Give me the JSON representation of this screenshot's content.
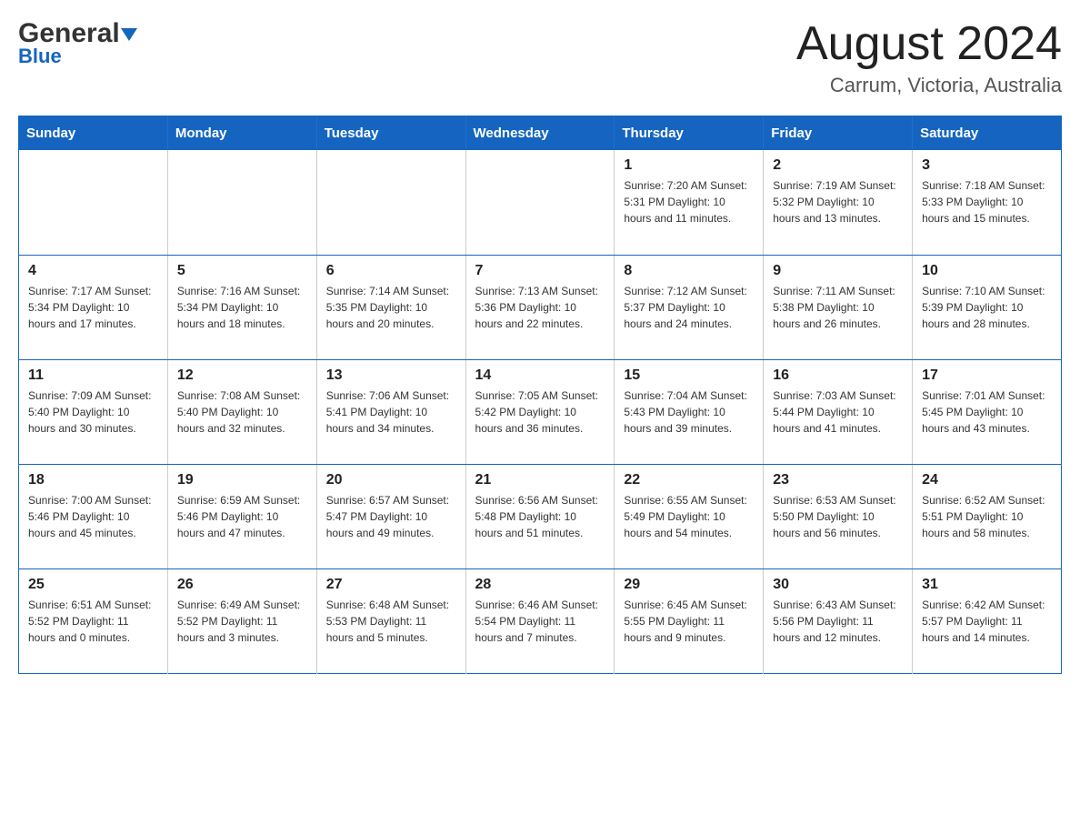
{
  "header": {
    "logo_general": "General",
    "logo_blue": "Blue",
    "title": "August 2024",
    "subtitle": "Carrum, Victoria, Australia"
  },
  "days_of_week": [
    "Sunday",
    "Monday",
    "Tuesday",
    "Wednesday",
    "Thursday",
    "Friday",
    "Saturday"
  ],
  "weeks": [
    [
      {
        "num": "",
        "info": ""
      },
      {
        "num": "",
        "info": ""
      },
      {
        "num": "",
        "info": ""
      },
      {
        "num": "",
        "info": ""
      },
      {
        "num": "1",
        "info": "Sunrise: 7:20 AM\nSunset: 5:31 PM\nDaylight: 10 hours\nand 11 minutes."
      },
      {
        "num": "2",
        "info": "Sunrise: 7:19 AM\nSunset: 5:32 PM\nDaylight: 10 hours\nand 13 minutes."
      },
      {
        "num": "3",
        "info": "Sunrise: 7:18 AM\nSunset: 5:33 PM\nDaylight: 10 hours\nand 15 minutes."
      }
    ],
    [
      {
        "num": "4",
        "info": "Sunrise: 7:17 AM\nSunset: 5:34 PM\nDaylight: 10 hours\nand 17 minutes."
      },
      {
        "num": "5",
        "info": "Sunrise: 7:16 AM\nSunset: 5:34 PM\nDaylight: 10 hours\nand 18 minutes."
      },
      {
        "num": "6",
        "info": "Sunrise: 7:14 AM\nSunset: 5:35 PM\nDaylight: 10 hours\nand 20 minutes."
      },
      {
        "num": "7",
        "info": "Sunrise: 7:13 AM\nSunset: 5:36 PM\nDaylight: 10 hours\nand 22 minutes."
      },
      {
        "num": "8",
        "info": "Sunrise: 7:12 AM\nSunset: 5:37 PM\nDaylight: 10 hours\nand 24 minutes."
      },
      {
        "num": "9",
        "info": "Sunrise: 7:11 AM\nSunset: 5:38 PM\nDaylight: 10 hours\nand 26 minutes."
      },
      {
        "num": "10",
        "info": "Sunrise: 7:10 AM\nSunset: 5:39 PM\nDaylight: 10 hours\nand 28 minutes."
      }
    ],
    [
      {
        "num": "11",
        "info": "Sunrise: 7:09 AM\nSunset: 5:40 PM\nDaylight: 10 hours\nand 30 minutes."
      },
      {
        "num": "12",
        "info": "Sunrise: 7:08 AM\nSunset: 5:40 PM\nDaylight: 10 hours\nand 32 minutes."
      },
      {
        "num": "13",
        "info": "Sunrise: 7:06 AM\nSunset: 5:41 PM\nDaylight: 10 hours\nand 34 minutes."
      },
      {
        "num": "14",
        "info": "Sunrise: 7:05 AM\nSunset: 5:42 PM\nDaylight: 10 hours\nand 36 minutes."
      },
      {
        "num": "15",
        "info": "Sunrise: 7:04 AM\nSunset: 5:43 PM\nDaylight: 10 hours\nand 39 minutes."
      },
      {
        "num": "16",
        "info": "Sunrise: 7:03 AM\nSunset: 5:44 PM\nDaylight: 10 hours\nand 41 minutes."
      },
      {
        "num": "17",
        "info": "Sunrise: 7:01 AM\nSunset: 5:45 PM\nDaylight: 10 hours\nand 43 minutes."
      }
    ],
    [
      {
        "num": "18",
        "info": "Sunrise: 7:00 AM\nSunset: 5:46 PM\nDaylight: 10 hours\nand 45 minutes."
      },
      {
        "num": "19",
        "info": "Sunrise: 6:59 AM\nSunset: 5:46 PM\nDaylight: 10 hours\nand 47 minutes."
      },
      {
        "num": "20",
        "info": "Sunrise: 6:57 AM\nSunset: 5:47 PM\nDaylight: 10 hours\nand 49 minutes."
      },
      {
        "num": "21",
        "info": "Sunrise: 6:56 AM\nSunset: 5:48 PM\nDaylight: 10 hours\nand 51 minutes."
      },
      {
        "num": "22",
        "info": "Sunrise: 6:55 AM\nSunset: 5:49 PM\nDaylight: 10 hours\nand 54 minutes."
      },
      {
        "num": "23",
        "info": "Sunrise: 6:53 AM\nSunset: 5:50 PM\nDaylight: 10 hours\nand 56 minutes."
      },
      {
        "num": "24",
        "info": "Sunrise: 6:52 AM\nSunset: 5:51 PM\nDaylight: 10 hours\nand 58 minutes."
      }
    ],
    [
      {
        "num": "25",
        "info": "Sunrise: 6:51 AM\nSunset: 5:52 PM\nDaylight: 11 hours\nand 0 minutes."
      },
      {
        "num": "26",
        "info": "Sunrise: 6:49 AM\nSunset: 5:52 PM\nDaylight: 11 hours\nand 3 minutes."
      },
      {
        "num": "27",
        "info": "Sunrise: 6:48 AM\nSunset: 5:53 PM\nDaylight: 11 hours\nand 5 minutes."
      },
      {
        "num": "28",
        "info": "Sunrise: 6:46 AM\nSunset: 5:54 PM\nDaylight: 11 hours\nand 7 minutes."
      },
      {
        "num": "29",
        "info": "Sunrise: 6:45 AM\nSunset: 5:55 PM\nDaylight: 11 hours\nand 9 minutes."
      },
      {
        "num": "30",
        "info": "Sunrise: 6:43 AM\nSunset: 5:56 PM\nDaylight: 11 hours\nand 12 minutes."
      },
      {
        "num": "31",
        "info": "Sunrise: 6:42 AM\nSunset: 5:57 PM\nDaylight: 11 hours\nand 14 minutes."
      }
    ]
  ]
}
